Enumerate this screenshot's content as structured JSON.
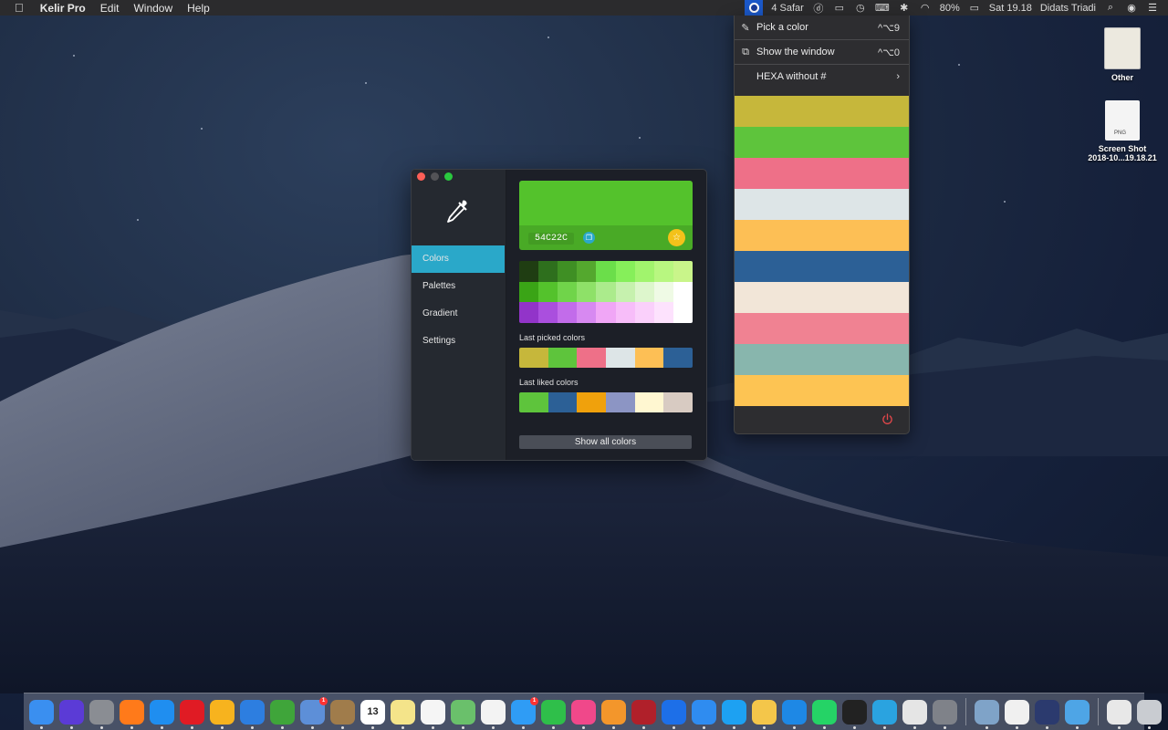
{
  "menubar": {
    "app_name": "Kelir Pro",
    "menus": [
      "Edit",
      "Window",
      "Help"
    ],
    "status": {
      "safari_count": "4 Safar",
      "battery": "80%",
      "clock": "Sat 19.18",
      "user": "Didats Triadi"
    }
  },
  "dropdown": {
    "items": [
      {
        "label": "Pick a color",
        "shortcut": "^⌥9",
        "icon": "eyedropper-icon"
      },
      {
        "label": "Show the window",
        "shortcut": "^⌥0",
        "icon": "external-window-icon"
      },
      {
        "label": "HEXA without #",
        "shortcut": "›",
        "icon": "none"
      }
    ],
    "swatches": [
      "#C6B73B",
      "#5EC43C",
      "#EE7088",
      "#DDE5E7",
      "#FDBF55",
      "#2C6096",
      "#F2E6D8",
      "#F08292",
      "#88B6AD",
      "#FDC453"
    ],
    "power_color": "#E2474A"
  },
  "desktop_icons": [
    {
      "label": "Other"
    },
    {
      "label": "Screen Shot\n2018-10...19.18.21",
      "line1": "Screen Shot",
      "line2": "2018-10...19.18.21",
      "file_tag": "PNG"
    }
  ],
  "window": {
    "nav": [
      "Colors",
      "Palettes",
      "Gradient",
      "Settings"
    ],
    "selected_nav": "Colors",
    "current_color": "#54C22C",
    "hex_value": "54C22C",
    "shades": [
      [
        "#1F3D12",
        "#2E6F1D",
        "#3F8F24",
        "#54A82E",
        "#6BDE4A",
        "#86EF5A",
        "#A1F46D",
        "#B8F780",
        "#C9F58A"
      ],
      [
        "#3AA416",
        "#54C22C",
        "#70D44A",
        "#8EE168",
        "#ABEB8C",
        "#C6F1AE",
        "#DDF6CC",
        "#EFFAE5",
        "#FFFFFF"
      ],
      [
        "#9234C9",
        "#AA4FDE",
        "#C26CEA",
        "#D789F1",
        "#F0A6F6",
        "#F7BDF9",
        "#FAD0FB",
        "#FDE2FD",
        "#FFFFFF"
      ]
    ],
    "last_picked_title": "Last picked colors",
    "last_picked": [
      "#C6B73B",
      "#5EC43C",
      "#EE7088",
      "#DDE5E7",
      "#FDBF55",
      "#2C6096"
    ],
    "last_liked_title": "Last liked colors",
    "last_liked": [
      "#5EC43C",
      "#2C6096",
      "#F0A10C",
      "#8C95C4",
      "#FFF7D1",
      "#D8CBC2"
    ],
    "show_all_label": "Show all colors"
  },
  "dock": {
    "apps": [
      {
        "name": "finder-icon",
        "color": "#3a8ff0"
      },
      {
        "name": "siri-icon",
        "color": "#5b3bd6"
      },
      {
        "name": "launchpad-icon",
        "color": "#8a8d93"
      },
      {
        "name": "firefox-icon",
        "color": "#ff7a1a"
      },
      {
        "name": "safari-icon",
        "color": "#1f8ef0"
      },
      {
        "name": "opera-icon",
        "color": "#e01b24"
      },
      {
        "name": "sketch-icon",
        "color": "#f7b31e"
      },
      {
        "name": "xcode-icon",
        "color": "#2d7ee0"
      },
      {
        "name": "leaf-app-icon",
        "color": "#3fa53a"
      },
      {
        "name": "mail-icon",
        "color": "#5d8fd8",
        "badge": "1"
      },
      {
        "name": "notebook-icon",
        "color": "#a07c4b"
      },
      {
        "name": "calendar-icon",
        "color": "#ffffff",
        "text": "13"
      },
      {
        "name": "notes-icon",
        "color": "#f4e48a"
      },
      {
        "name": "reminders-icon",
        "color": "#f5f5f5"
      },
      {
        "name": "maps-icon",
        "color": "#6ac06b"
      },
      {
        "name": "photos-icon",
        "color": "#f3f3f3"
      },
      {
        "name": "messages-icon",
        "color": "#2f9cf5",
        "badge": "1"
      },
      {
        "name": "facetime-icon",
        "color": "#2fbf4a"
      },
      {
        "name": "itunes-icon",
        "color": "#f0488a"
      },
      {
        "name": "books-icon",
        "color": "#f3962b"
      },
      {
        "name": "photo-booth-icon",
        "color": "#b0202a"
      },
      {
        "name": "location-icon",
        "color": "#1d6fe8"
      },
      {
        "name": "app-store-icon",
        "color": "#2f8cf0"
      },
      {
        "name": "twitter-icon",
        "color": "#1da1f2"
      },
      {
        "name": "stack-app-icon",
        "color": "#f4c64a"
      },
      {
        "name": "vpn-shield-icon",
        "color": "#1e88e5"
      },
      {
        "name": "whatsapp-icon",
        "color": "#25d366"
      },
      {
        "name": "terminal-icon",
        "color": "#222222"
      },
      {
        "name": "telegram-icon",
        "color": "#2aa3e0"
      },
      {
        "name": "sublime-icon",
        "color": "#e5e5e5"
      },
      {
        "name": "system-preferences-icon",
        "color": "#7f8289"
      }
    ],
    "right_apps": [
      {
        "name": "preview-icon",
        "color": "#7fa3c8"
      },
      {
        "name": "kelir-icon",
        "color": "#f0f0f0"
      },
      {
        "name": "screen-capture-icon",
        "color": "#2b3a6e"
      },
      {
        "name": "edge-icon",
        "color": "#4ea5e6"
      }
    ],
    "trailing": [
      {
        "name": "document-stack-icon",
        "color": "#e8e8e8"
      },
      {
        "name": "trash-icon",
        "color": "#c9ccd1"
      }
    ]
  }
}
